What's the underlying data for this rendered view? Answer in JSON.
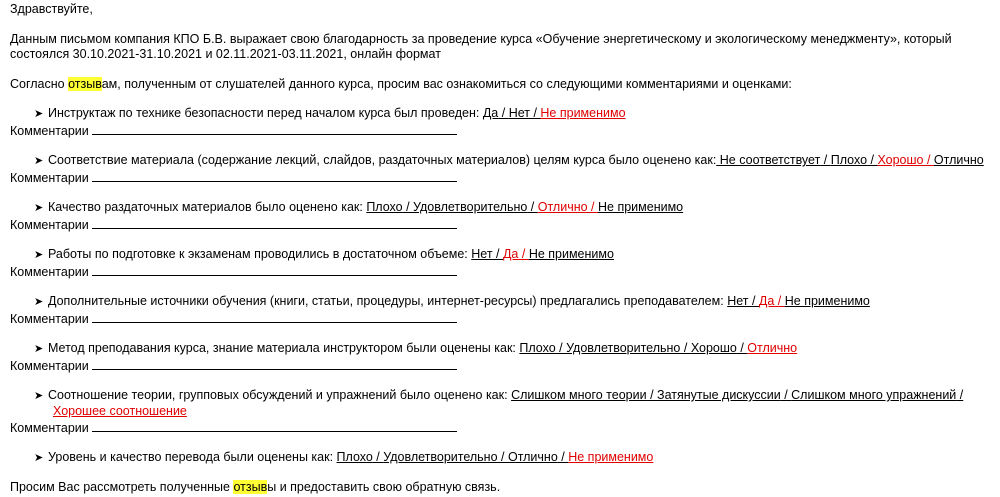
{
  "greeting": "Здравствуйте,",
  "intro": {
    "text": "Данным письмом компания КПО Б.В. выражает свою благодарность за проведение курса «Обучение энергетическому и экологическому менеджменту», который состоялся 30.10.2021-31.10.2021 и 02.11.2021-03.11.2021, онлайн формат"
  },
  "lead": {
    "prefix": "Согласно ",
    "highlight": "отзыв",
    "suffix": "ам, полученным от слушателей данного курса, просим вас ознакомиться со следующими комментариями и оценками:"
  },
  "bullet_glyph": "➤",
  "comment_label": "Комментарии",
  "questions": [
    {
      "text": "Инструктаж по технике безопасности перед началом курса был проведен: ",
      "options": [
        "Да",
        "Нет",
        "Не применимо"
      ],
      "selected": 2,
      "lead_space": false
    },
    {
      "text": "Соответствие материала (содержание лекций, слайдов, раздаточных материалов) целям курса было оценено как:",
      "options": [
        " Не соответствует",
        "Плохо",
        "Хорошо",
        "Отлично"
      ],
      "selected": 2,
      "lead_space": false
    },
    {
      "text": "Качество раздаточных материалов было оценено как: ",
      "options": [
        "Плохо",
        "Удовлетворительно",
        "Отлично",
        "Не применимо"
      ],
      "selected": 2
    },
    {
      "text": "Работы по подготовке к экзаменам проводились в достаточном объеме: ",
      "options": [
        "Нет",
        "Да",
        "Не применимо"
      ],
      "selected": 1
    },
    {
      "text": "Дополнительные источники обучения (книги, статьи, процедуры, интернет-ресурсы) предлагались преподавателем: ",
      "options": [
        "Нет",
        "Да",
        "Не применимо"
      ],
      "selected": 1
    },
    {
      "text": "Метод преподавания курса, знание материала инструктором были оценены как: ",
      "options": [
        "Плохо",
        "Удовлетворительно",
        "Хорошо",
        "Отлично"
      ],
      "selected": 3
    },
    {
      "text": "Соотношение теории, групповых обсуждений и упражнений было оценено как: ",
      "options": [
        "Слишком много теории",
        "Затянутые дискуссии",
        "Слишком много упражнений",
        "Хорошее соотношение"
      ],
      "selected": 3,
      "wrap_last": true
    },
    {
      "text": "Уровень и качество перевода были оценены как: ",
      "options": [
        "Плохо",
        "Удовлетворительно",
        "Отлично",
        "Не применимо"
      ],
      "selected": 3,
      "no_comment": true
    }
  ],
  "closing": {
    "prefix": "Просим Вас рассмотреть полученные ",
    "highlight": "отзыв",
    "suffix": "ы и предоставить свою обратную связь."
  }
}
